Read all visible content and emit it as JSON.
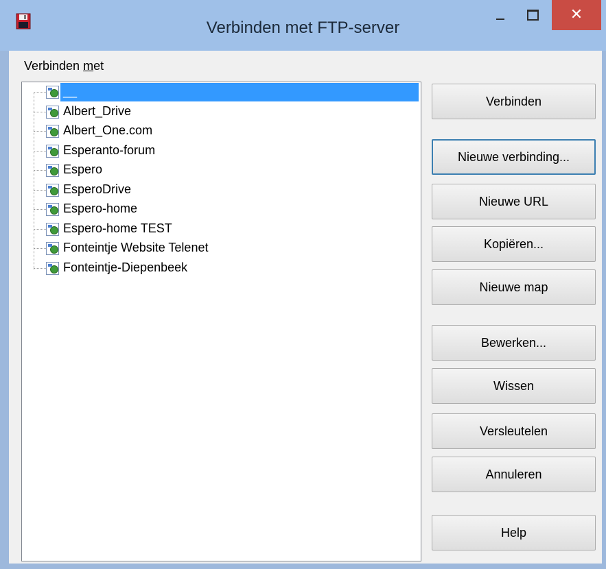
{
  "window": {
    "title": "Verbinden met FTP-server",
    "close_glyph": "✕"
  },
  "group": {
    "label_prefix": "Verbinden ",
    "label_accel": "m",
    "label_suffix": "et"
  },
  "tree": {
    "selected_index": 0,
    "items": [
      {
        "label": "__"
      },
      {
        "label": "Albert_Drive"
      },
      {
        "label": "Albert_One.com"
      },
      {
        "label": "Esperanto-forum"
      },
      {
        "label": "Espero"
      },
      {
        "label": "EsperoDrive"
      },
      {
        "label": "Espero-home"
      },
      {
        "label": "Espero-home TEST"
      },
      {
        "label": "Fonteintje Website Telenet"
      },
      {
        "label": "Fonteintje-Diepenbeek"
      }
    ]
  },
  "buttons": {
    "connect": "Verbinden",
    "new_connection": "Nieuwe verbinding...",
    "new_url": "Nieuwe URL",
    "copy": "Kopiëren...",
    "new_folder": "Nieuwe map",
    "edit": "Bewerken...",
    "delete": "Wissen",
    "encrypt": "Versleutelen",
    "cancel": "Annuleren",
    "help": "Help"
  },
  "colors": {
    "selection": "#3399ff",
    "close_button": "#c94c44",
    "titlebar": "#9fc0e8"
  },
  "icons": {
    "app": "floppy-disk-icon",
    "tree_node": "ftp-site-icon"
  }
}
